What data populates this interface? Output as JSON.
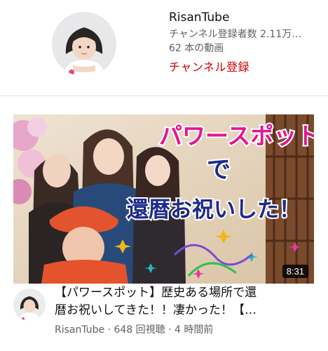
{
  "channel": {
    "name": "RisanTube",
    "subscribers": "チャンネル登録者数 2.11万…",
    "video_count": "62 本の動画",
    "subscribe_label": "チャンネル登録"
  },
  "video": {
    "duration": "8:31",
    "title_line1": "【パワースポット】歴史ある場所で還",
    "title_line2": "暦お祝いしてきた！！凄かった！【…",
    "meta": "RisanTube · 648 回視聴 · 4 時間前",
    "thumbnail_text": {
      "line1": "パワースポット",
      "line2": "で",
      "line3": "還暦お祝いした！"
    }
  },
  "colors": {
    "accent": "#cc0000",
    "thumb_title_pink": "#e8148f",
    "thumb_title_blue": "#1d2a8a"
  }
}
